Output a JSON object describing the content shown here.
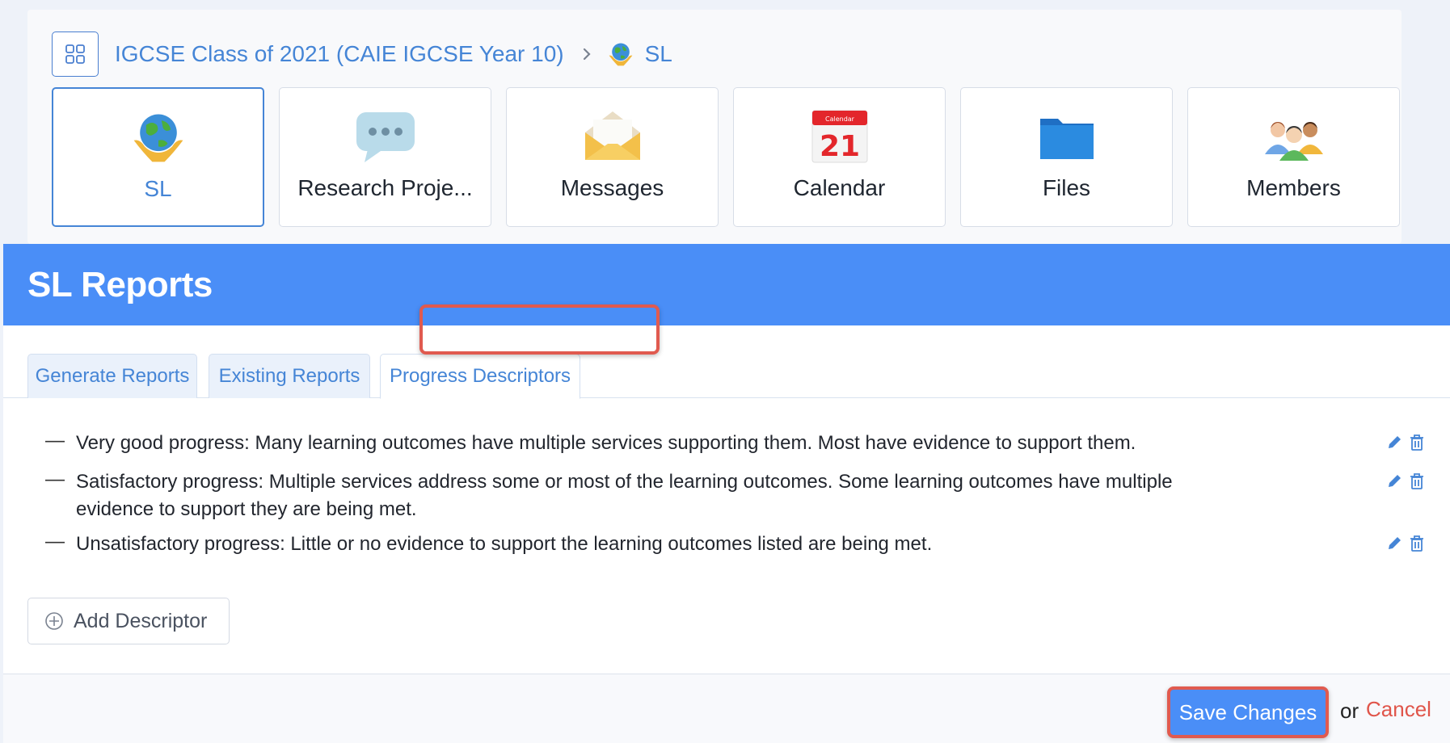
{
  "breadcrumb": {
    "class_name": "IGCSE Class of 2021 (CAIE IGCSE Year 10)",
    "current": "SL"
  },
  "tiles": [
    {
      "label": "SL",
      "icon": "globe-hands-icon",
      "active": true
    },
    {
      "label": "Research Proje...",
      "icon": "chat-bubble-icon",
      "active": false
    },
    {
      "label": "Messages",
      "icon": "envelope-icon",
      "active": false
    },
    {
      "label": "Calendar",
      "icon": "calendar-icon",
      "active": false,
      "day": "21",
      "month": "Calendar"
    },
    {
      "label": "Files",
      "icon": "folder-icon",
      "active": false
    },
    {
      "label": "Members",
      "icon": "people-icon",
      "active": false
    }
  ],
  "panel": {
    "title": "SL Reports",
    "tabs": [
      "Generate Reports",
      "Existing Reports",
      "Progress Descriptors"
    ],
    "active_tab": "Progress Descriptors"
  },
  "descriptors": [
    "Very good progress: Many learning outcomes have multiple services supporting them. Most have evidence to support them.",
    "Satisfactory progress: Multiple services address some or most of the learning outcomes. Some learning outcomes have multiple evidence to support they are being met.",
    "Unsatisfactory progress: Little or no evidence to support the learning outcomes listed are being met."
  ],
  "actions": {
    "add_descriptor": "Add Descriptor",
    "save": "Save Changes",
    "or": "or",
    "cancel": "Cancel"
  },
  "colors": {
    "accent": "#4a8ef7",
    "link": "#4585d6",
    "highlight": "#e05a4f",
    "cancel": "#e0554a"
  }
}
